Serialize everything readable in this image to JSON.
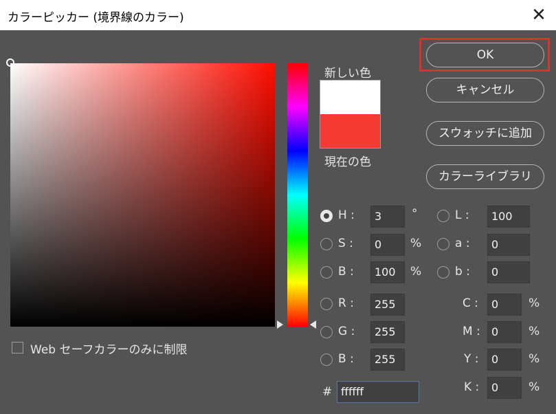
{
  "window": {
    "title": "カラーピッカー (境界線のカラー)"
  },
  "preview": {
    "new_label": "新しい色",
    "current_label": "現在の色",
    "new_color": "#ffffff",
    "current_color": "#f53a33"
  },
  "buttons": {
    "ok": "OK",
    "cancel": "キャンセル",
    "add_swatch": "スウォッチに追加",
    "color_library": "カラーライブラリ"
  },
  "hsb": {
    "h": {
      "label": "H :",
      "value": "3",
      "unit": "°"
    },
    "s": {
      "label": "S :",
      "value": "0",
      "unit": "%"
    },
    "b": {
      "label": "B :",
      "value": "100",
      "unit": "%"
    }
  },
  "rgb": {
    "r": {
      "label": "R :",
      "value": "255"
    },
    "g": {
      "label": "G :",
      "value": "255"
    },
    "b": {
      "label": "B :",
      "value": "255"
    }
  },
  "lab": {
    "l": {
      "label": "L :",
      "value": "100"
    },
    "a": {
      "label": "a :",
      "value": "0"
    },
    "b": {
      "label": "b :",
      "value": "0"
    }
  },
  "cmyk": {
    "c": {
      "label": "C :",
      "value": "0",
      "unit": "%"
    },
    "m": {
      "label": "M :",
      "value": "0",
      "unit": "%"
    },
    "y": {
      "label": "Y :",
      "value": "0",
      "unit": "%"
    },
    "k": {
      "label": "K :",
      "value": "0",
      "unit": "%"
    }
  },
  "hex": {
    "label": "#",
    "value": "ffffff"
  },
  "web_safe": {
    "label": "Web セーフカラーのみに制限",
    "checked": false
  },
  "colors": {
    "hue_base": "#ff0d00",
    "highlight": "#e0302a"
  }
}
